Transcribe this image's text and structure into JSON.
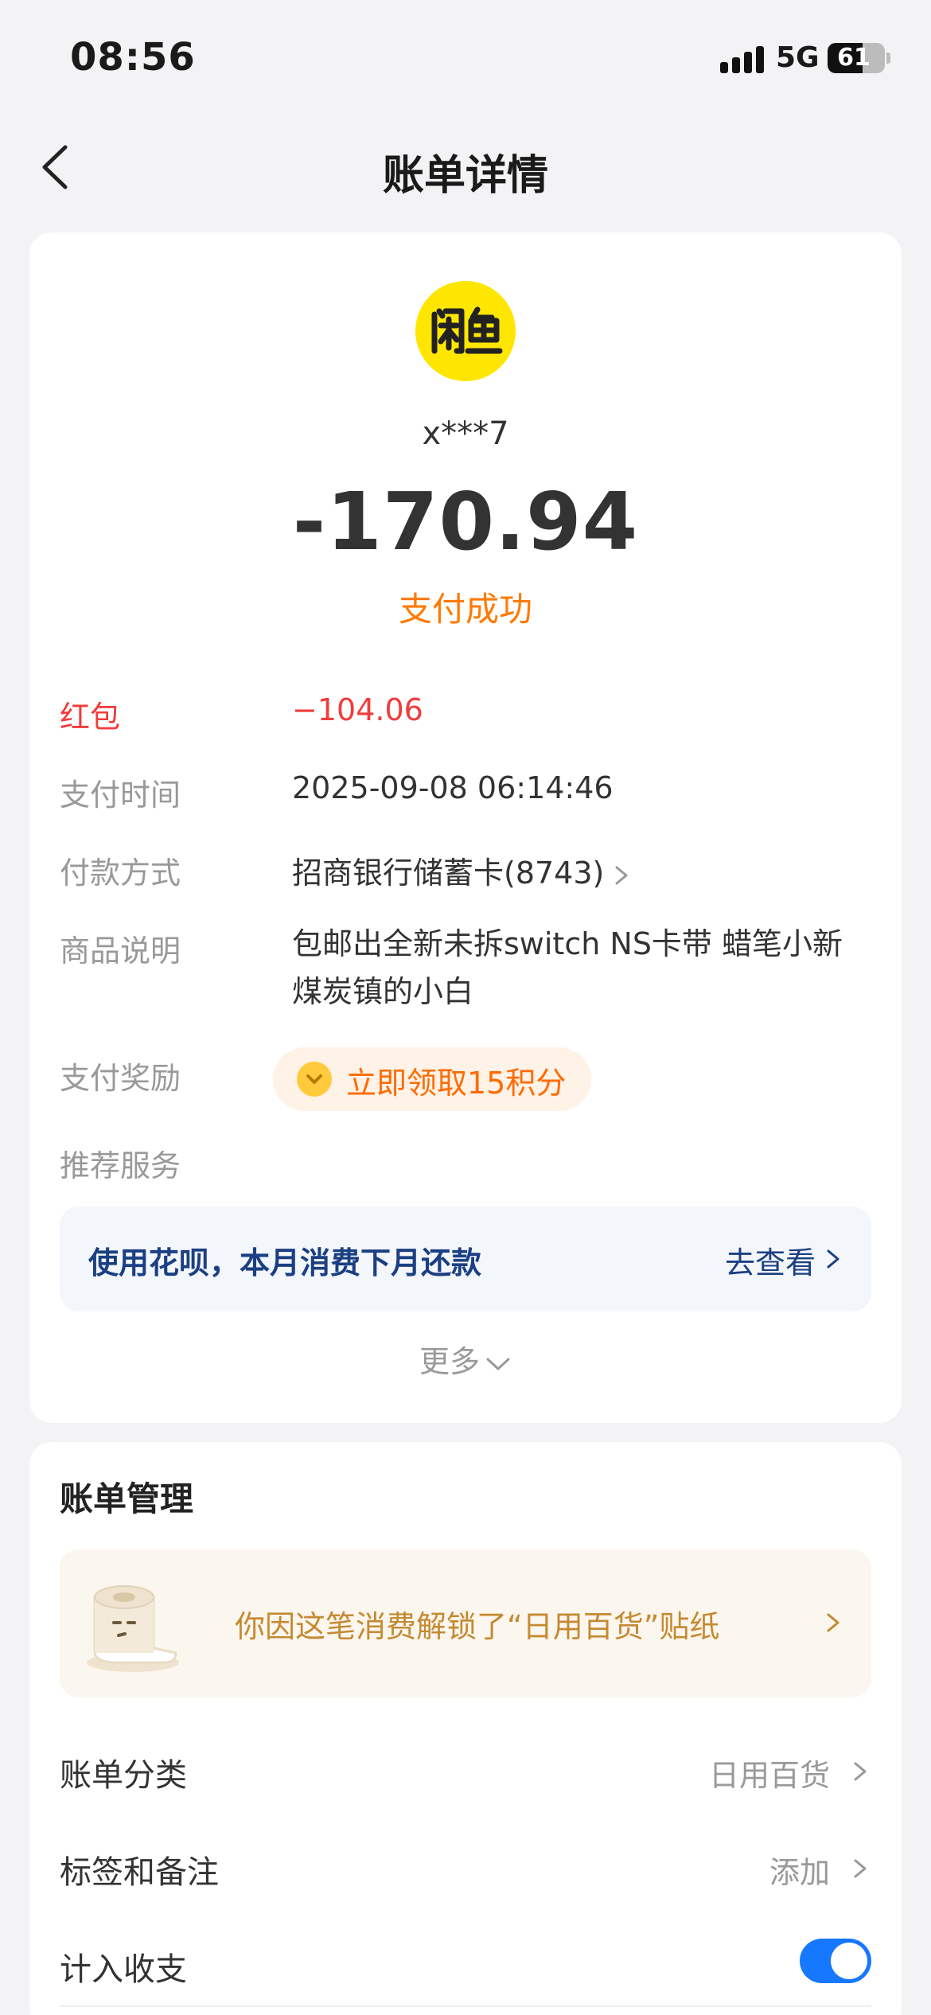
{
  "status_bar": {
    "time": "08:56",
    "network": "5G",
    "battery_level": "61",
    "battery_fraction": 0.61
  },
  "nav": {
    "back_icon": "chevron-left-icon",
    "title": "账单详情"
  },
  "bill": {
    "merchant_logo_text": "闲鱼",
    "merchant_logo_color": "#ffe600",
    "merchant_name": "x***7",
    "amount": "-170.94",
    "status": "支付成功",
    "status_color": "#ff7a00",
    "details": {
      "red_packet": {
        "label": "红包",
        "value": "−104.06"
      },
      "pay_time": {
        "label": "支付时间",
        "value": "2025-09-08 06:14:46"
      },
      "pay_method": {
        "label": "付款方式",
        "value": "招商银行储蓄卡(8743)"
      },
      "description": {
        "label": "商品说明",
        "value": "包邮出全新未拆switch NS卡带 蜡笔小新 煤炭镇的小白"
      },
      "reward": {
        "label": "支付奖励",
        "value": "立即领取15积分"
      },
      "recommend": {
        "label": "推荐服务"
      }
    },
    "huabei": {
      "text": "使用花呗，本月消费下月还款",
      "link": "去查看"
    },
    "more": "更多"
  },
  "manage": {
    "title": "账单管理",
    "sticker_text": "你因这笔消费解锁了“日用百货”贴纸",
    "rows": {
      "category": {
        "label": "账单分类",
        "value": "日用百货"
      },
      "tags": {
        "label": "标签和备注",
        "value": "添加"
      },
      "include": {
        "label": "计入收支",
        "enabled": true
      }
    }
  },
  "colors": {
    "accent_blue": "#1677ff",
    "red": "#f23c3c",
    "orange": "#ff6a00"
  }
}
